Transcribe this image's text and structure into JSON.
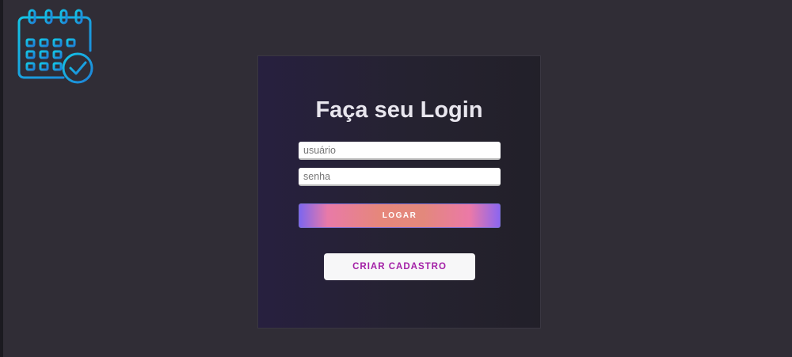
{
  "app": {
    "logo_icon": "calendar-check-icon",
    "logo_color": "#1a9fe0"
  },
  "login": {
    "title": "Faça seu Login",
    "username_placeholder": "usuário",
    "username_value": "",
    "password_placeholder": "senha",
    "password_value": "",
    "login_button_label": "LOGAR",
    "signup_button_label": "CRIAR CADASTRO"
  },
  "colors": {
    "background": "#302d36",
    "signup_text": "#a31fa6",
    "login_gradient": [
      "#7d66ee",
      "#e87aa8",
      "#e6877b",
      "#8c66f0"
    ]
  }
}
